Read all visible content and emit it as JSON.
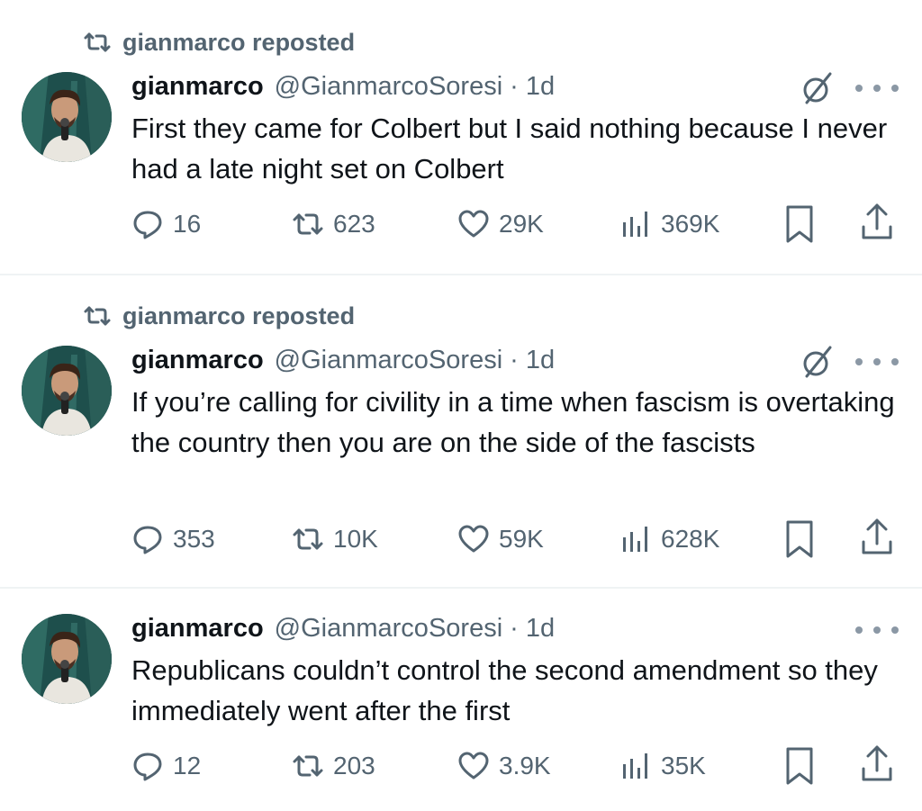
{
  "tweets": [
    {
      "repost_label": "gianmarco reposted",
      "name": "gianmarco",
      "handle": "@GianmarcoSoresi",
      "separator": "·",
      "time": "1d",
      "text": "First they came for Colbert but I said nothing because I never had a late night set on Colbert",
      "replies": "16",
      "reposts": "623",
      "likes": "29K",
      "views": "369K",
      "has_grok": true
    },
    {
      "repost_label": "gianmarco reposted",
      "name": "gianmarco",
      "handle": "@GianmarcoSoresi",
      "separator": "·",
      "time": "1d",
      "text": "If you’re calling for civility in a time when fascism is overtaking the country then you are on the side of the fascists",
      "replies": "353",
      "reposts": "10K",
      "likes": "59K",
      "views": "628K",
      "has_grok": true
    },
    {
      "repost_label": "",
      "name": "gianmarco",
      "handle": "@GianmarcoSoresi",
      "separator": "·",
      "time": "1d",
      "text": "Republicans couldn’t control the second amendment so they immediately went after the first",
      "replies": "12",
      "reposts": "203",
      "likes": "3.9K",
      "views": "35K",
      "has_grok": false
    }
  ],
  "colors": {
    "text_primary": "#0f1419",
    "text_secondary": "#536471",
    "divider": "#eff3f4"
  },
  "icons": {
    "repost": "repost-icon",
    "reply": "reply-icon",
    "like": "heart-icon",
    "views": "views-icon",
    "bookmark": "bookmark-icon",
    "share": "share-icon",
    "grok": "grok-icon",
    "more": "more-icon"
  }
}
